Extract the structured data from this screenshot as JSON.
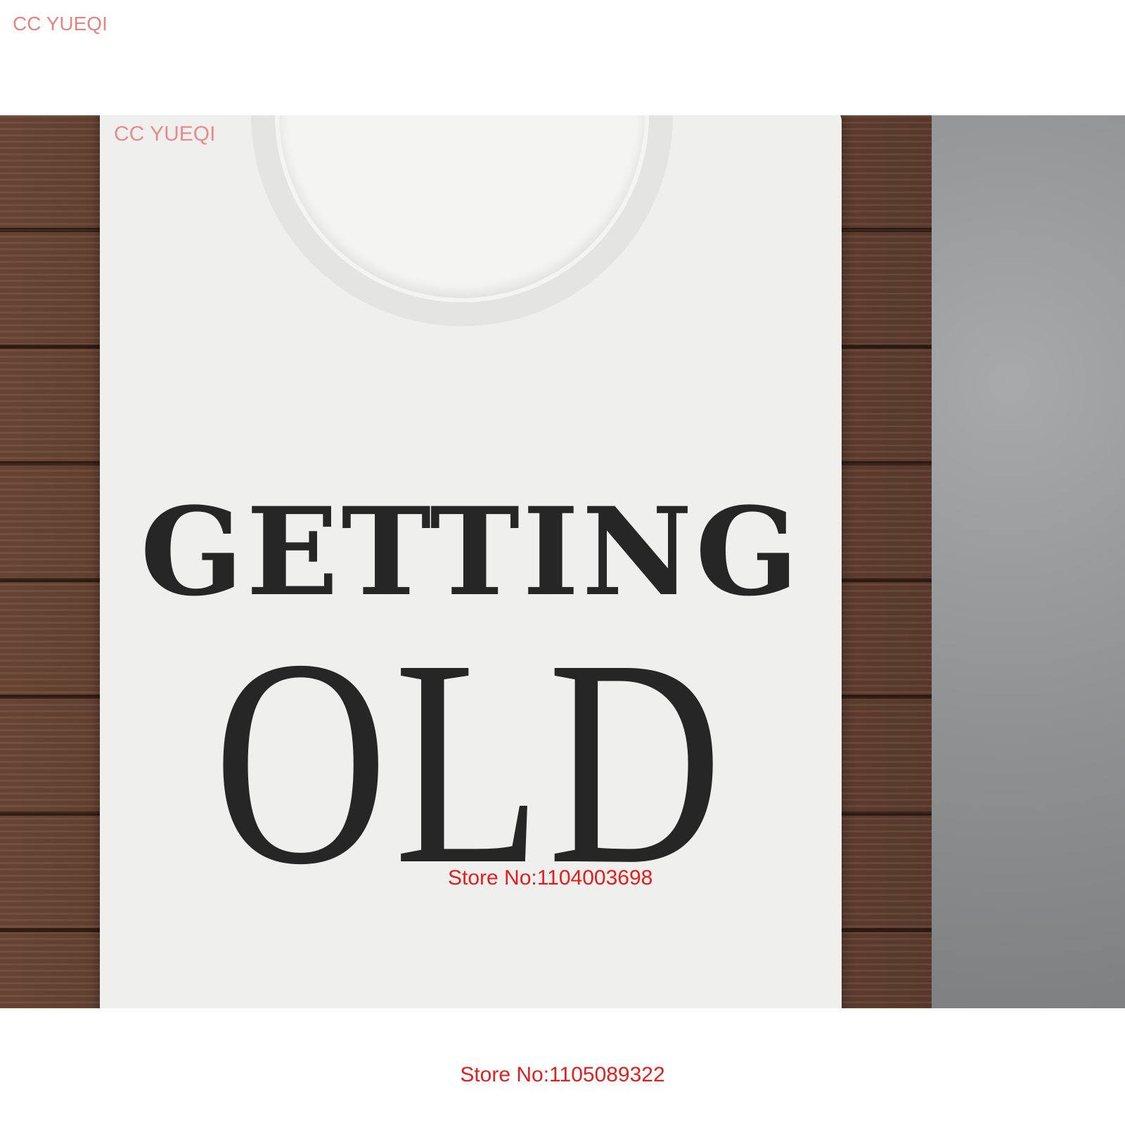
{
  "watermark": {
    "brand": "CC YUEQI"
  },
  "shirt": {
    "line1": "GETTING",
    "line2": "OLD"
  },
  "store": {
    "inner": "Store No:1104003698",
    "bottom": "Store No:1105089322"
  },
  "colors": {
    "store_text": "#e0201e",
    "brand_text": "#e8837f",
    "print_text": "#262626"
  }
}
